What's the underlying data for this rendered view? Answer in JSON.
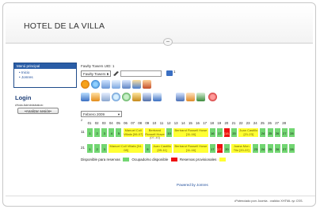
{
  "site": {
    "title": "HOTEL DE LA VILLA"
  },
  "menu": {
    "heading": "Menú principal",
    "items": [
      {
        "label": "Inicio"
      },
      {
        "label": "Jomres"
      }
    ]
  },
  "login": {
    "title": "Login",
    "subtitle": "•Hola Administrator•",
    "button_label": "•Analizar sesión•"
  },
  "booking": {
    "hotel_uid_label": "Fawlty Towers UID: 1",
    "hotel_select_value": "Fawlty Towers 1",
    "count_label": "1",
    "month_select_value": "Febrero 2009",
    "small_number": "2",
    "days": [
      "01",
      "02",
      "03",
      "04",
      "05",
      "06",
      "07",
      "08",
      "09",
      "10",
      "11",
      "12",
      "13",
      "14",
      "15",
      "16",
      "17",
      "18",
      "19",
      "20",
      "21",
      "22",
      "23",
      "24",
      "25",
      "26",
      "27",
      "28"
    ],
    "rooms": [
      {
        "label": "11",
        "cells": [
          {
            "text": "1",
            "type": "green"
          },
          {
            "text": "2",
            "type": "green"
          },
          {
            "text": "3",
            "type": "green"
          },
          {
            "text": "4",
            "type": "green"
          },
          {
            "text": "5",
            "type": "green"
          },
          {
            "text": "Manuel Coll Villafa [06-07]",
            "type": "yellow",
            "span": 3
          },
          {
            "text": "Bertrand Russell Howe [07-10]",
            "type": "yellow",
            "span": 3
          },
          {
            "text": "10",
            "type": "green"
          },
          {
            "text": "Bertrand Russell Howe [11-16]",
            "type": "yellow",
            "span": 5
          },
          {
            "text": "16",
            "type": "green"
          },
          {
            "text": "17",
            "type": "green"
          },
          {
            "text": "[18-19]",
            "type": "red"
          },
          {
            "text": "20",
            "type": "green"
          },
          {
            "text": "Juan Castillo [21-23]",
            "type": "yellow",
            "span": 3
          },
          {
            "text": "24",
            "type": "green"
          },
          {
            "text": "25",
            "type": "green"
          },
          {
            "text": "26",
            "type": "green"
          },
          {
            "text": "27",
            "type": "green"
          },
          {
            "text": "28",
            "type": "green"
          }
        ]
      },
      {
        "label": "21",
        "cells": [
          {
            "text": "1",
            "type": "green"
          },
          {
            "text": "2",
            "type": "green"
          },
          {
            "text": "3",
            "type": "green"
          },
          {
            "text": "Manuel Coll Villafa [04-08]",
            "type": "yellow",
            "span": 5
          },
          {
            "text": "9",
            "type": "green"
          },
          {
            "text": "Juan Castillo [09-11]",
            "type": "yellow",
            "span": 3
          },
          {
            "text": "Bertrand Russell Howe [11-16]",
            "type": "yellow",
            "span": 5
          },
          {
            "text": "17",
            "type": "green"
          },
          {
            "text": "[17-19]",
            "type": "red"
          },
          {
            "text": "20",
            "type": "green"
          },
          {
            "text": "Juana Mon Tilo [20-22]",
            "type": "yellow",
            "span": 3
          },
          {
            "text": "23",
            "type": "green"
          },
          {
            "text": "24",
            "type": "green"
          },
          {
            "text": "25",
            "type": "green"
          },
          {
            "text": "26",
            "type": "green"
          },
          {
            "text": "27",
            "type": "green"
          },
          {
            "text": "28",
            "type": "green"
          }
        ]
      }
    ],
    "legend": {
      "available": "Disponible para reservas",
      "occupied": "Ocupado/no disponible",
      "provisional": "Reservas provisionales"
    }
  },
  "footer": {
    "powered_by": "Powered by Jomres",
    "bottom": "•Potenciado por• Joomla . •valido• XHTML •y• CSS."
  },
  "colors": {
    "available": "#72d672",
    "occupied": "#ee1111",
    "provisional": "#ffff33",
    "menu_header": "#2a5da6"
  }
}
